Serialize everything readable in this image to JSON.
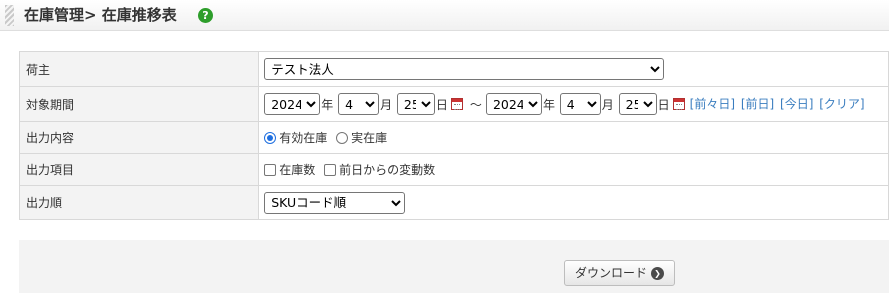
{
  "header": {
    "title": "在庫管理> 在庫推移表",
    "help_glyph": "?"
  },
  "form": {
    "owner": {
      "label": "荷主",
      "value": "テスト法人"
    },
    "period": {
      "label": "対象期間",
      "from": {
        "year": "2024",
        "month": "4",
        "day": "25"
      },
      "to": {
        "year": "2024",
        "month": "4",
        "day": "25"
      },
      "unit_year": "年",
      "unit_month": "月",
      "unit_day": "日",
      "tilde": "～",
      "links": {
        "prev_prev": "[前々日]",
        "prev": "[前日]",
        "today": "[今日]",
        "clear": "[クリア]"
      }
    },
    "content": {
      "label": "出力内容",
      "options": [
        {
          "text": "有効在庫",
          "checked": true
        },
        {
          "text": "実在庫",
          "checked": false
        }
      ]
    },
    "items": {
      "label": "出力項目",
      "options": [
        {
          "text": "在庫数",
          "checked": false
        },
        {
          "text": "前日からの変動数",
          "checked": false
        }
      ]
    },
    "order": {
      "label": "出力順",
      "value": "SKUコード順"
    }
  },
  "footer": {
    "download_label": "ダウンロード",
    "download_glyph": "❯"
  }
}
